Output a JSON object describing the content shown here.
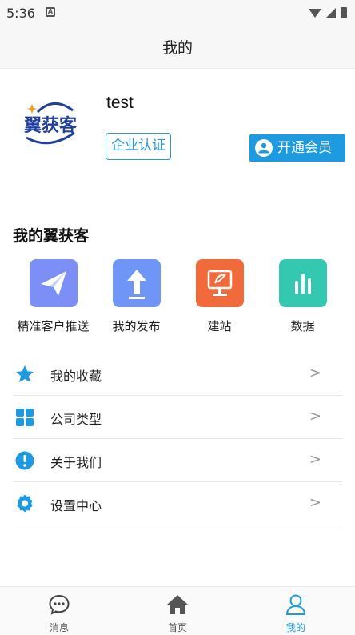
{
  "status_bar": {
    "time": "5:36",
    "notification": "A"
  },
  "app_bar": {
    "title": "我的"
  },
  "profile": {
    "logo_text": "翼获客",
    "username": "test",
    "cert_button": "企业认证",
    "vip_button": "开通会员"
  },
  "section": {
    "title": "我的翼获客"
  },
  "features": [
    {
      "label": "精准客户推送",
      "icon": "paper-plane-icon",
      "color": "#7b8ff7"
    },
    {
      "label": "我的发布",
      "icon": "upload-arrow-icon",
      "color": "#6f95f7"
    },
    {
      "label": "建站",
      "icon": "monitor-icon",
      "color": "#f06a3c"
    },
    {
      "label": "数据",
      "icon": "bar-chart-icon",
      "color": "#35c8b0"
    }
  ],
  "menu": [
    {
      "label": "我的收藏",
      "icon": "star-icon",
      "arrow": ">"
    },
    {
      "label": "公司类型",
      "icon": "grid-icon",
      "arrow": ">"
    },
    {
      "label": "关于我们",
      "icon": "info-icon",
      "arrow": ">"
    },
    {
      "label": "设置中心",
      "icon": "gear-icon",
      "arrow": ">"
    }
  ],
  "tabs": [
    {
      "label": "消息",
      "icon": "chat-icon",
      "active": false
    },
    {
      "label": "首页",
      "icon": "home-icon",
      "active": false
    },
    {
      "label": "我的",
      "icon": "person-icon",
      "active": true
    }
  ],
  "colors": {
    "accent": "#1e9be0",
    "logo_blue": "#1f3f9a",
    "logo_orange": "#f39a1e"
  }
}
